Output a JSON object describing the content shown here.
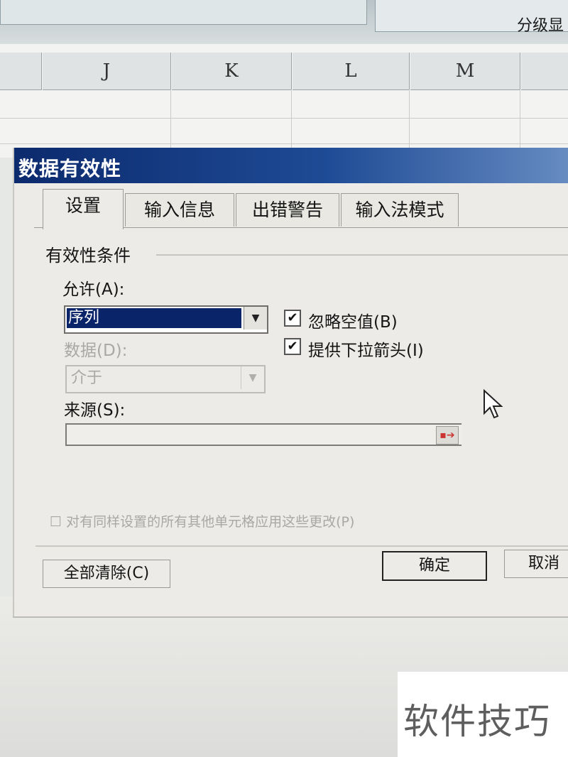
{
  "ribbon": {
    "label": "分级显"
  },
  "sheet": {
    "columns": [
      "J",
      "K",
      "L",
      "M"
    ]
  },
  "dialog": {
    "title": "数据有效性",
    "tabs": [
      "设置",
      "输入信息",
      "出错警告",
      "输入法模式"
    ],
    "group_title": "有效性条件",
    "allow_label": "允许(A):",
    "allow_value": "序列",
    "data_label": "数据(D):",
    "data_value": "介于",
    "ignore_blank_label": "忽略空值(B)",
    "dropdown_label": "提供下拉箭头(I)",
    "source_label": "来源(S):",
    "apply_all_label": "对有同样设置的所有其他单元格应用这些更改(P)",
    "clear_all_label": "全部清除(C)",
    "ok_label": "确定",
    "cancel_label": "取消"
  },
  "watermark": "软件技巧"
}
